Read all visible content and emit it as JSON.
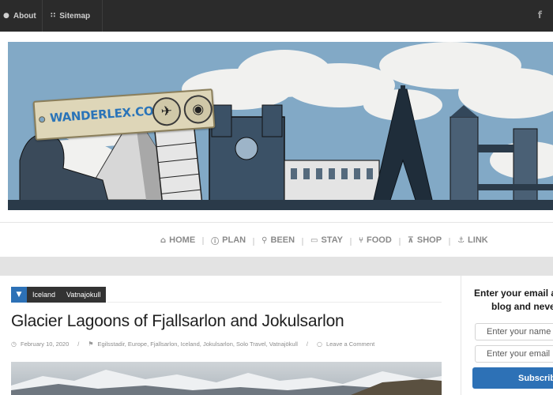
{
  "topbar": {
    "about_label": "About",
    "sitemap_label": "Sitemap",
    "facebook_glyph": "f",
    "about_icon": "user-icon",
    "sitemap_icon": "sitemap-icon"
  },
  "banner": {
    "brand": "WANDERLEX.COM",
    "badge_icons": [
      "airplane-icon",
      "camera-icon"
    ]
  },
  "nav": {
    "items": [
      {
        "label": "HOME",
        "icon": "home-icon",
        "glyph": "⌂"
      },
      {
        "label": "PLAN",
        "icon": "info-icon",
        "glyph": "ⓘ"
      },
      {
        "label": "BEEN",
        "icon": "map-marker-icon",
        "glyph": "⚲"
      },
      {
        "label": "STAY",
        "icon": "bed-icon",
        "glyph": "▭"
      },
      {
        "label": "FOOD",
        "icon": "cutlery-icon",
        "glyph": "⑂"
      },
      {
        "label": "SHOP",
        "icon": "cart-icon",
        "glyph": "⊼"
      },
      {
        "label": "LINK",
        "icon": "anchor-icon",
        "glyph": "⚓"
      }
    ]
  },
  "post": {
    "categories": [
      "Iceland",
      "Vatnajokull"
    ],
    "title": "Glacier Lagoons of Fjallsarlon and Jokulsarlon",
    "date": "February 10, 2020",
    "tags": "Egilsstadir, Europe, Fjallsarlon, Iceland, Jokulsarlon, Solo Travel, Vatnajökull",
    "comment": "Leave a Comment"
  },
  "sidebar": {
    "line1": "Enter your email ad",
    "line2": "blog and never",
    "name_placeholder": "Enter your name",
    "email_placeholder": "Enter your email",
    "subscribe_label": "Subscribe"
  },
  "colors": {
    "topbar": "#2b2b2b",
    "accent": "#2d71b6",
    "category_bg": "#333333",
    "nav_text": "#8a8a8a"
  }
}
